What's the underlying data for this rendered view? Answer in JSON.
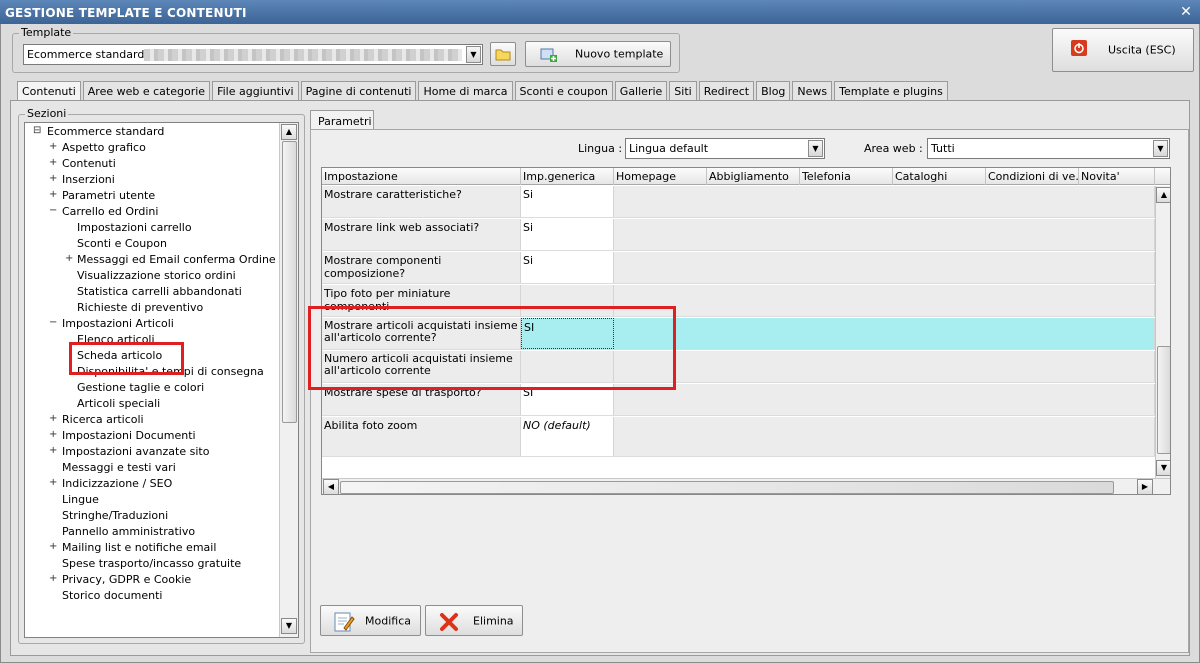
{
  "window": {
    "title": "GESTIONE TEMPLATE E CONTENUTI",
    "close_glyph": "✕"
  },
  "template_group": {
    "label": "Template",
    "selected": "Ecommerce standard",
    "new_button": "Nuovo template"
  },
  "exit_button": "Uscita (ESC)",
  "tabs": [
    "Contenuti",
    "Aree web e categorie",
    "File aggiuntivi",
    "Pagine di contenuti",
    "Home di marca",
    "Sconti e coupon",
    "Gallerie",
    "Siti",
    "Redirect",
    "Blog",
    "News",
    "Template e plugins"
  ],
  "sections": {
    "label": "Sezioni",
    "items": [
      "Ecommerce standard",
      "Aspetto grafico",
      "Contenuti",
      "Inserzioni",
      "Parametri utente",
      "Carrello ed Ordini",
      "Impostazioni carrello",
      "Sconti e Coupon",
      "Messaggi ed Email conferma Ordine",
      "Visualizzazione storico ordini",
      "Statistica carrelli abbandonati",
      "Richieste di preventivo",
      "Impostazioni Articoli",
      "Elenco articoli",
      "Scheda articolo",
      "Disponibilita' e tempi di consegna",
      "Gestione taglie e colori",
      "Articoli speciali",
      "Ricerca articoli",
      "Impostazioni Documenti",
      "Impostazioni avanzate sito",
      "Messaggi e testi vari",
      "Indicizzazione / SEO",
      "Lingue",
      "Stringhe/Traduzioni",
      "Pannello amministrativo",
      "Mailing list e notifiche email",
      "Spese trasporto/incasso gratuite",
      "Privacy, GDPR e Cookie",
      "Storico documenti"
    ]
  },
  "params_tab": "Parametri",
  "filters": {
    "lingua_label": "Lingua :",
    "lingua_value": "Lingua default",
    "area_label": "Area web :",
    "area_value": "Tutti"
  },
  "grid": {
    "columns": [
      "Impostazione",
      "Imp.generica",
      "Homepage",
      "Abbigliamento",
      "Telefonia",
      "Cataloghi",
      "Condizioni di ve...",
      "Novita'"
    ],
    "rows": [
      {
        "label": "Mostrare caratteristiche?",
        "value": "Si"
      },
      {
        "label": "Mostrare link web associati?",
        "value": "Si"
      },
      {
        "label": "Mostrare componenti composizione?",
        "value": "Si"
      },
      {
        "label": "Tipo foto per miniature componenti",
        "value": ""
      },
      {
        "label": "Mostrare articoli acquistati insieme all'articolo corrente?",
        "value": "SI"
      },
      {
        "label": "Numero articoli acquistati insieme all'articolo corrente",
        "value": ""
      },
      {
        "label": "Mostrare spese di trasporto?",
        "value": "SI"
      },
      {
        "label": "Abilita foto zoom",
        "value": "NO (default)"
      }
    ]
  },
  "actions": {
    "modify": "Modifica",
    "delete": "Elimina"
  },
  "colors": {
    "selected_row": "#a8eef0",
    "highlight_box": "#e02020",
    "titlebar": "#4a73a8"
  }
}
